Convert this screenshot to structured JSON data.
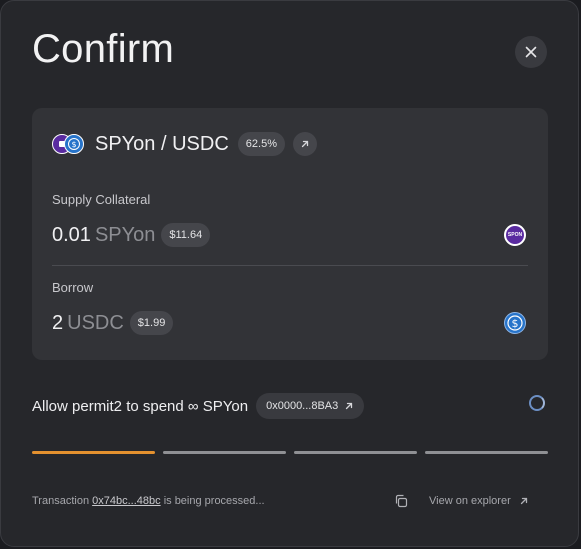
{
  "dialog": {
    "title": "Confirm"
  },
  "pair": {
    "label": "SPYon / USDC",
    "percent": "62.5%"
  },
  "supply": {
    "label": "Supply Collateral",
    "amount": "0.01",
    "symbol": "SPYon",
    "usd": "$11.64",
    "icon_text": "SPON"
  },
  "borrow": {
    "label": "Borrow",
    "amount": "2",
    "symbol": "USDC",
    "usd": "$1.99",
    "icon_text": "$"
  },
  "step": {
    "text": "Allow permit2 to spend ∞ SPYon",
    "address": "0x0000...8BA3",
    "progress": [
      {
        "state": "active",
        "color": "#e4912f"
      },
      {
        "state": "pending",
        "color": "#8f9094"
      },
      {
        "state": "pending",
        "color": "#8f9094"
      },
      {
        "state": "pending",
        "color": "#8f9094"
      }
    ]
  },
  "footer": {
    "prefix": "Transaction",
    "tx_hash": "0x74bc...48bc",
    "suffix": "is being processed...",
    "explorer_label": "View on explorer"
  },
  "colors": {
    "accent_orange": "#e4912f",
    "spyon_purple": "#5a2ba0",
    "usdc_blue": "#2774ca"
  }
}
